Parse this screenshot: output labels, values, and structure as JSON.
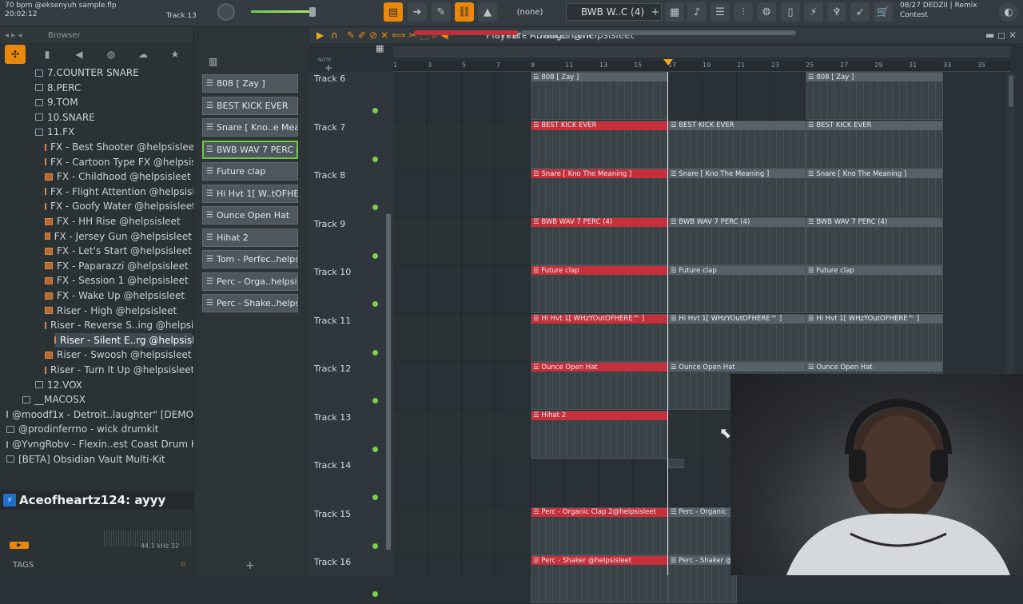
{
  "topbar": {
    "song_info": "70 bpm @eksenyuh sample.flp",
    "time": "20:02:12",
    "track_label": "Track 13",
    "pattern_none": "(none)",
    "pattern_selector": "BWB W..C (4)",
    "hint_line1": "08/27  DEDZII | Remix",
    "hint_line2": "Contest"
  },
  "browser": {
    "title": "Browser",
    "items": [
      {
        "label": "7.COUNTER SNARE",
        "kind": "folder",
        "indent": 1
      },
      {
        "label": "8.PERC",
        "kind": "folder",
        "indent": 1
      },
      {
        "label": "9.TOM",
        "kind": "folder",
        "indent": 1
      },
      {
        "label": "10.SNARE",
        "kind": "folder",
        "indent": 1
      },
      {
        "label": "11.FX",
        "kind": "folder",
        "indent": 1
      },
      {
        "label": "FX - Best Shooter @helpsisleet",
        "kind": "file",
        "indent": 2
      },
      {
        "label": "FX - Cartoon Type FX @helpsisleet",
        "kind": "file",
        "indent": 2
      },
      {
        "label": "FX - Childhood @helpsisleet",
        "kind": "file",
        "indent": 2
      },
      {
        "label": "FX - Flight Attention @helpsisleet",
        "kind": "file",
        "indent": 2
      },
      {
        "label": "FX - Goofy Water @helpsisleet",
        "kind": "file",
        "indent": 2
      },
      {
        "label": "FX - HH Rise @helpsisleet",
        "kind": "file",
        "indent": 2
      },
      {
        "label": "FX - Jersey Gun @helpsisleet",
        "kind": "file",
        "indent": 2
      },
      {
        "label": "FX - Let's Start @helpsisleet",
        "kind": "file",
        "indent": 2
      },
      {
        "label": "FX - Paparazzi @helpsisleet",
        "kind": "file",
        "indent": 2
      },
      {
        "label": "FX - Session 1 @helpsisleet",
        "kind": "file",
        "indent": 2
      },
      {
        "label": "FX - Wake Up @helpsisleet",
        "kind": "file",
        "indent": 2
      },
      {
        "label": "Riser - High @helpsisleet",
        "kind": "file",
        "indent": 2
      },
      {
        "label": "Riser - Reverse S..ing @helpsisleet",
        "kind": "file",
        "indent": 2
      },
      {
        "label": "Riser - Silent E..rg @helpsisleet",
        "kind": "file",
        "indent": 3,
        "selected": true
      },
      {
        "label": "Riser - Swoosh @helpsisleet",
        "kind": "file",
        "indent": 2
      },
      {
        "label": "Riser - Turn It Up @helpsisleet",
        "kind": "file",
        "indent": 2
      },
      {
        "label": "12.VOX",
        "kind": "folder",
        "indent": 1
      },
      {
        "label": "__MACOSX",
        "kind": "folder",
        "indent": 0
      },
      {
        "label": "@moodf1x - Detroit..laughter\" [DEMO]",
        "kind": "folder",
        "indent": -1
      },
      {
        "label": "@prodinferrno - wick drumkit",
        "kind": "folder",
        "indent": -1
      },
      {
        "label": "@YvngRobv - Flexin..est Coast Drum Kit",
        "kind": "folder",
        "indent": -1
      },
      {
        "label": "[BETA] Obsidian Vault Multi-Kit",
        "kind": "folder",
        "indent": -1
      }
    ],
    "tags_label": "TAGS",
    "status": "44.1 kHz 32"
  },
  "chat": {
    "user": "Aceofheartz124",
    "message": ": ayyy"
  },
  "channels": [
    {
      "label": "808 [ Zay ]"
    },
    {
      "label": "BEST KICK EVER"
    },
    {
      "label": "Snare [ Kno..e Meaning ]"
    },
    {
      "label": "BWB WAV 7 PERC (4)",
      "selected": true
    },
    {
      "label": "Future clap"
    },
    {
      "label": "Hi Hvt 1[ W..tOFHERE™ ]"
    },
    {
      "label": "Ounce Open Hat"
    },
    {
      "label": "Hihat 2"
    },
    {
      "label": "Tom - Perfec..helpsisleet"
    },
    {
      "label": "Perc - Orga..helpsisleet"
    },
    {
      "label": "Perc - Shake..helpsisleet"
    }
  ],
  "playlist": {
    "title": "Playlist - Arrangement",
    "breadcrumb_sep": "›",
    "pattern_name": "Perc - Shaker @helpsisleet",
    "ruler_ticks": [
      "1",
      "3",
      "5",
      "7",
      "9",
      "11",
      "13",
      "15",
      "17",
      "19",
      "21",
      "23",
      "25",
      "27",
      "29",
      "31",
      "33",
      "35"
    ],
    "tracks": [
      "Track 6",
      "Track 7",
      "Track 8",
      "Track 9",
      "Track 10",
      "Track 11",
      "Track 12",
      "Track 13",
      "Track 14",
      "Track 15",
      "Track 16"
    ],
    "clips": [
      {
        "track": 0,
        "label": "808 [ Zay ]",
        "start": 9,
        "len": 4,
        "red": false
      },
      {
        "track": 0,
        "label": "808 [ Zay ]",
        "start": 25,
        "len": 4,
        "red": false
      },
      {
        "track": 1,
        "label": "BEST KICK EVER",
        "start": 9,
        "len": 4,
        "red": true
      },
      {
        "track": 1,
        "label": "BEST KICK EVER",
        "start": 17,
        "len": 4,
        "red": false
      },
      {
        "track": 1,
        "label": "BEST KICK EVER",
        "start": 25,
        "len": 4,
        "red": false
      },
      {
        "track": 2,
        "label": "Snare [ Kno The Meaning ]",
        "start": 9,
        "len": 4,
        "red": true
      },
      {
        "track": 2,
        "label": "Snare [ Kno The Meaning ]",
        "start": 17,
        "len": 4,
        "red": false
      },
      {
        "track": 2,
        "label": "Snare [ Kno The Meaning ]",
        "start": 25,
        "len": 4,
        "red": false
      },
      {
        "track": 3,
        "label": "BWB WAV 7 PERC (4)",
        "start": 9,
        "len": 4,
        "red": true
      },
      {
        "track": 3,
        "label": "BWB WAV 7 PERC (4)",
        "start": 17,
        "len": 4,
        "red": false
      },
      {
        "track": 3,
        "label": "BWB WAV 7 PERC (4)",
        "start": 25,
        "len": 4,
        "red": false
      },
      {
        "track": 4,
        "label": "Future clap",
        "start": 9,
        "len": 4,
        "red": true
      },
      {
        "track": 4,
        "label": "Future clap",
        "start": 17,
        "len": 4,
        "red": false
      },
      {
        "track": 4,
        "label": "Future clap",
        "start": 25,
        "len": 4,
        "red": false
      },
      {
        "track": 5,
        "label": "Hi Hvt 1[ WHzYOutOFHERE™ ]",
        "start": 9,
        "len": 4,
        "red": true
      },
      {
        "track": 5,
        "label": "Hi Hvt 1[ WHzYOutOFHERE™ ]",
        "start": 17,
        "len": 4,
        "red": false
      },
      {
        "track": 5,
        "label": "Hi Hvt 1[ WHzYOutOFHERE™ ]",
        "start": 25,
        "len": 4,
        "red": false
      },
      {
        "track": 6,
        "label": "Ounce Open Hat",
        "start": 9,
        "len": 4,
        "red": true
      },
      {
        "track": 6,
        "label": "Ounce Open Hat",
        "start": 17,
        "len": 4,
        "red": false
      },
      {
        "track": 6,
        "label": "Ounce Open Hat",
        "start": 25,
        "len": 4,
        "red": false
      },
      {
        "track": 7,
        "label": "Hihat 2",
        "start": 9,
        "len": 4,
        "red": true
      },
      {
        "track": 9,
        "label": "Perc - Organic Clap 2@helpsisleet",
        "start": 9,
        "len": 4,
        "red": true
      },
      {
        "track": 9,
        "label": "Perc - Organic",
        "start": 17,
        "len": 2,
        "red": false
      },
      {
        "track": 10,
        "label": "Perc - Shaker @helpsisleet",
        "start": 9,
        "len": 4,
        "red": true
      },
      {
        "track": 10,
        "label": "Perc - Shaker @",
        "start": 17,
        "len": 2,
        "red": false
      }
    ]
  },
  "icons": {
    "play": "▶",
    "folder": "folder-icon",
    "audio_file": "audio-file-icon"
  },
  "colors": {
    "accent_orange": "#e8890c",
    "clip_red": "#c7303b",
    "selection_green": "#6ecb3c"
  }
}
